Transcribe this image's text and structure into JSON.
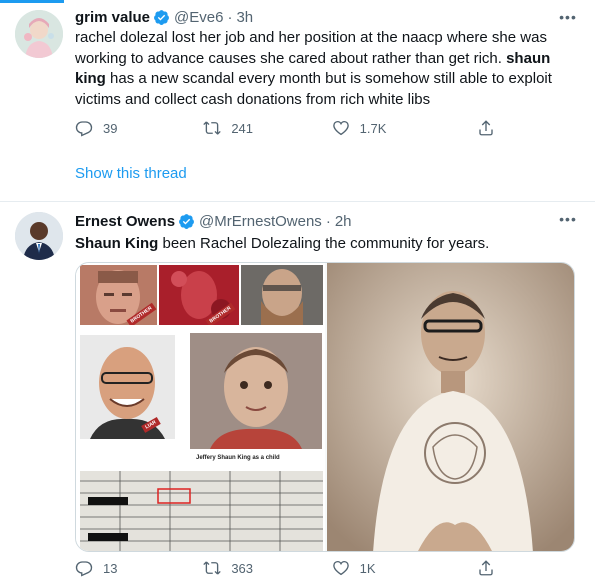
{
  "tweets": [
    {
      "name": "grim value",
      "handle": "@Eve6",
      "time": "3h",
      "text_parts": [
        "rachel dolezal lost her job and her position at the naacp where she was working to advance causes she cared about rather than get rich. ",
        "shaun king",
        " has a new scandal every month but is somehow still able to exploit victims and collect cash donations from rich white libs"
      ],
      "replies": "39",
      "retweets": "241",
      "likes": "1.7K",
      "show_thread": "Show this thread"
    },
    {
      "name": "Ernest Owens",
      "handle": "@MrErnestOwens",
      "time": "2h",
      "text_parts": [
        "Shaun King",
        " been Rachel Dolezaling the community for years."
      ],
      "replies": "13",
      "retweets": "363",
      "likes": "1K",
      "media": {
        "caption": "Jeffery Shaun King as a child",
        "stamp1": "BROTHER",
        "stamp2": "BROTHER",
        "stamp3": "LIAR"
      }
    }
  ],
  "icons": {
    "verified": "verified-badge-icon",
    "more": "more-options-icon",
    "reply": "reply-icon",
    "retweet": "retweet-icon",
    "like": "heart-icon",
    "share": "share-icon"
  },
  "colors": {
    "accent": "#1d9bf0",
    "muted": "#536471",
    "text": "#0f1419",
    "divider": "#e6ecf0"
  }
}
